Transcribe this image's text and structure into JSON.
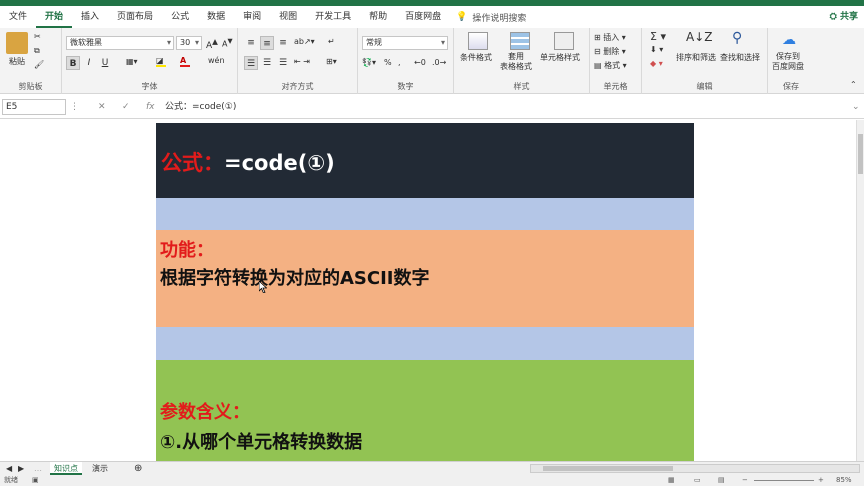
{
  "ribbon_tabs": [
    "文件",
    "开始",
    "插入",
    "页面布局",
    "公式",
    "数据",
    "审阅",
    "视图",
    "开发工具",
    "帮助",
    "百度网盘"
  ],
  "active_tab_index": 1,
  "tell_me": "操作说明搜索",
  "share_label": "共享",
  "clipboard": {
    "paste": "粘贴",
    "group_label": "剪贴板"
  },
  "font": {
    "name": "微软雅黑",
    "size": "30",
    "bold": "B",
    "italic": "I",
    "underline": "U",
    "group_label": "字体"
  },
  "alignment": {
    "group_label": "对齐方式"
  },
  "number": {
    "format": "常规",
    "group_label": "数字"
  },
  "styles": {
    "conditional": "条件格式",
    "table_format": "套用\n表格格式",
    "cell_styles": "单元格样式",
    "group_label": "样式"
  },
  "cells": {
    "insert": "插入",
    "delete": "删除",
    "format": "格式",
    "group_label": "单元格"
  },
  "editing": {
    "sort_filter": "排序和筛选",
    "find_select": "查找和选择",
    "group_label": "编辑"
  },
  "save": {
    "label": "保存到\n百度网盘",
    "group_label": "保存"
  },
  "formula_bar": {
    "name_box": "E5",
    "formula": "公式：=code(①)"
  },
  "sheet": {
    "formula_label": "公式：",
    "formula_value": "=code(①)",
    "function_label": "功能：",
    "function_desc": "根据字符转换为对应的ASCII数字",
    "param_label": "参数含义：",
    "param_desc": "①.从哪个单元格转换数据"
  },
  "sheet_tabs": [
    "知识点",
    "演示"
  ],
  "active_sheet_index": 0,
  "status": {
    "ready": "就绪",
    "zoom": "85%"
  },
  "colors": {
    "accent": "#217346",
    "dark_band": "#222a35",
    "blue_band": "#b4c6e7",
    "orange_band": "#f4b183",
    "green_band": "#92c353",
    "red_text": "#e21b1b"
  }
}
